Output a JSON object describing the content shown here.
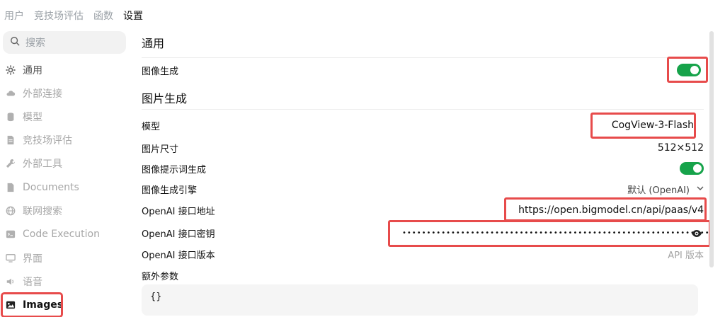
{
  "topnav": {
    "items": [
      "用户",
      "竞技场评估",
      "函数",
      "设置"
    ],
    "active_index": 3
  },
  "sidebar": {
    "search_placeholder": "搜索",
    "items": [
      {
        "label": "通用",
        "icon": "gear-icon"
      },
      {
        "label": "外部连接",
        "icon": "cloud-icon"
      },
      {
        "label": "模型",
        "icon": "database-icon"
      },
      {
        "label": "竞技场评估",
        "icon": "document-icon"
      },
      {
        "label": "外部工具",
        "icon": "wrench-icon"
      },
      {
        "label": "Documents",
        "icon": "file-icon"
      },
      {
        "label": "联网搜索",
        "icon": "globe-icon"
      },
      {
        "label": "Code Execution",
        "icon": "terminal-icon"
      },
      {
        "label": "界面",
        "icon": "monitor-icon"
      },
      {
        "label": "语音",
        "icon": "speaker-icon"
      },
      {
        "label": "Images",
        "icon": "image-icon"
      }
    ],
    "active_item": "Images"
  },
  "main": {
    "section_general": {
      "title": "通用"
    },
    "image_generation": {
      "label": "图像生成",
      "enabled": true
    },
    "section_image": {
      "title": "图片生成"
    },
    "model": {
      "label": "模型",
      "value": "CogView-3-Flash"
    },
    "image_size": {
      "label": "图片尺寸",
      "value": "512×512"
    },
    "prompt_generation": {
      "label": "图像提示词生成",
      "enabled": true
    },
    "engine": {
      "label": "图像生成引擎",
      "value": "默认 (OpenAI)"
    },
    "api_url": {
      "label": "OpenAI 接口地址",
      "value": "https://open.bigmodel.cn/api/paas/v4"
    },
    "api_key": {
      "label": "OpenAI 接口密钥",
      "masked": "••••••••••••••••••••••••••••••••••••••••••••••••••••••••••••••••"
    },
    "api_version": {
      "label": "OpenAI 接口版本",
      "placeholder": "API 版本"
    },
    "extra_params": {
      "label": "额外参数",
      "value": "{}"
    }
  },
  "colors": {
    "accent_green": "#16a34a",
    "highlight_red": "#e74b4b"
  }
}
